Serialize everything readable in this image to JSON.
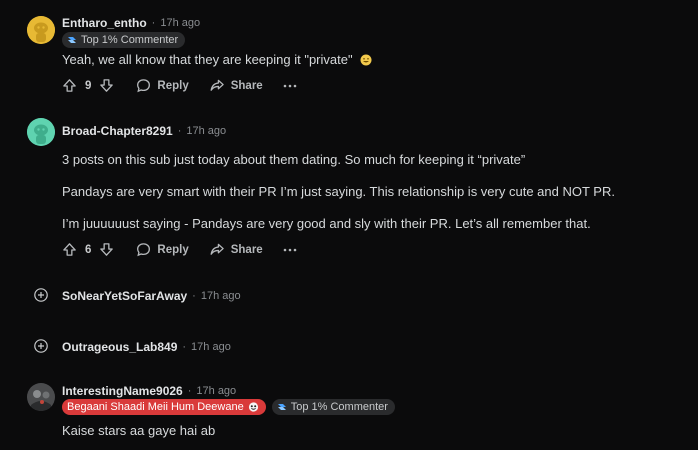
{
  "comments": [
    {
      "username": "Entharo_entho",
      "time": "17h ago",
      "badges": [
        {
          "label": "Top 1% Commenter",
          "type": "top"
        }
      ],
      "paragraphs": [
        "Yeah, we all know that they are keeping it \"private\""
      ],
      "votes": "9",
      "reply_label": "Reply",
      "share_label": "Share",
      "avatar_color": "#e7b934"
    },
    {
      "username": "Broad-Chapter8291",
      "time": "17h ago",
      "paragraphs": [
        "3 posts on this sub just today about them dating. So much for keeping it “private”",
        "Pandays are very smart with their PR I’m just saying. This relationship is very cute and NOT PR.",
        "I’m juuuuuust saying - Pandays are very good and sly with their PR. Let’s all remember that."
      ],
      "votes": "6",
      "reply_label": "Reply",
      "share_label": "Share",
      "avatar_color": "#5fd3b0"
    }
  ],
  "collapsed": [
    {
      "username": "SoNearYetSoFarAway",
      "time": "17h ago"
    },
    {
      "username": "Outrageous_Lab849",
      "time": "17h ago"
    }
  ],
  "last_comment": {
    "username": "InterestingName9026",
    "time": "17h ago",
    "flair": "Begaani Shaadi Meii Hum Deewane",
    "badge": "Top 1% Commenter",
    "text": "Kaise stars aa gaye hai ab"
  },
  "icons": {
    "upvote": "arrow-up-icon",
    "downvote": "arrow-down-icon",
    "reply": "comment-bubble-icon",
    "share": "share-arrow-icon",
    "more": "more-dots-icon",
    "expand": "plus-circle-icon",
    "emoji": "grinning-emoji-icon",
    "badge": "top-commenter-icon"
  },
  "colors": {
    "background": "#0b0b0c",
    "flair": "#d93a3a",
    "badge": "#2a2b2d"
  },
  "separator": "·"
}
